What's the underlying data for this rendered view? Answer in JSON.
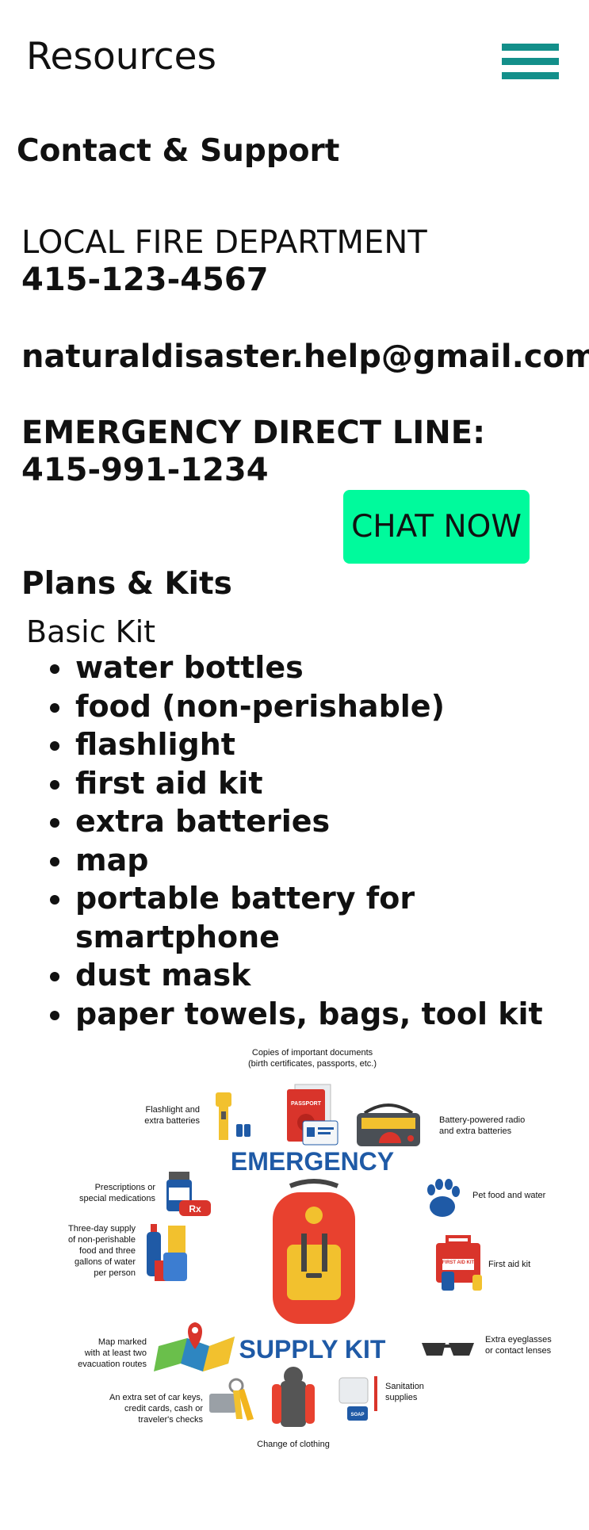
{
  "header": {
    "title": "Resources"
  },
  "contact": {
    "heading": "Contact & Support",
    "fire_label": "LOCAL FIRE DEPARTMENT",
    "fire_phone": "415-123-4567",
    "email": "naturaldisaster.help@gmail.com",
    "direct_label": "EMERGENCY DIRECT LINE:",
    "direct_phone": "415-991-1234",
    "chat_label": "CHAT NOW",
    "chat_color": "#00fa9c"
  },
  "plans": {
    "heading": "Plans & Kits",
    "kit_title": "Basic Kit",
    "items": [
      "water bottles",
      "food (non-perishable)",
      "flashlight",
      "first aid kit",
      "extra batteries",
      "map",
      "portable battery for smartphone",
      "dust mask",
      "paper towels, bags, tool kit"
    ]
  },
  "infographic": {
    "title_top": "EMERGENCY",
    "title_bottom": "SUPPLY KIT",
    "documents": [
      "Copies of important documents",
      "(birth certificates, passports, etc.)"
    ],
    "flashlight": [
      "Flashlight and",
      "extra batteries"
    ],
    "radio": [
      "Battery-powered radio",
      "and extra batteries"
    ],
    "prescriptions": [
      "Prescriptions or",
      "special medications"
    ],
    "pet": "Pet food and water",
    "water": [
      "Three-day supply",
      "of non-perishable",
      "food and three",
      "gallons of water",
      "per person"
    ],
    "firstaid": "First aid kit",
    "map": [
      "Map marked",
      "with at least two",
      "evacuation routes"
    ],
    "eyeglasses": [
      "Extra eyeglasses",
      "or contact lenses"
    ],
    "keys": [
      "An extra set of car keys,",
      "credit cards, cash or",
      "traveler's checks"
    ],
    "sanitation": [
      "Sanitation",
      "supplies"
    ],
    "clothing": "Change of clothing",
    "passport_label": "PASSPORT",
    "rx_label": "Rx",
    "firstaid_box_label": "FIRST AID KIT",
    "soap_label": "SOAP",
    "accent_color": "#1f5aa6"
  }
}
